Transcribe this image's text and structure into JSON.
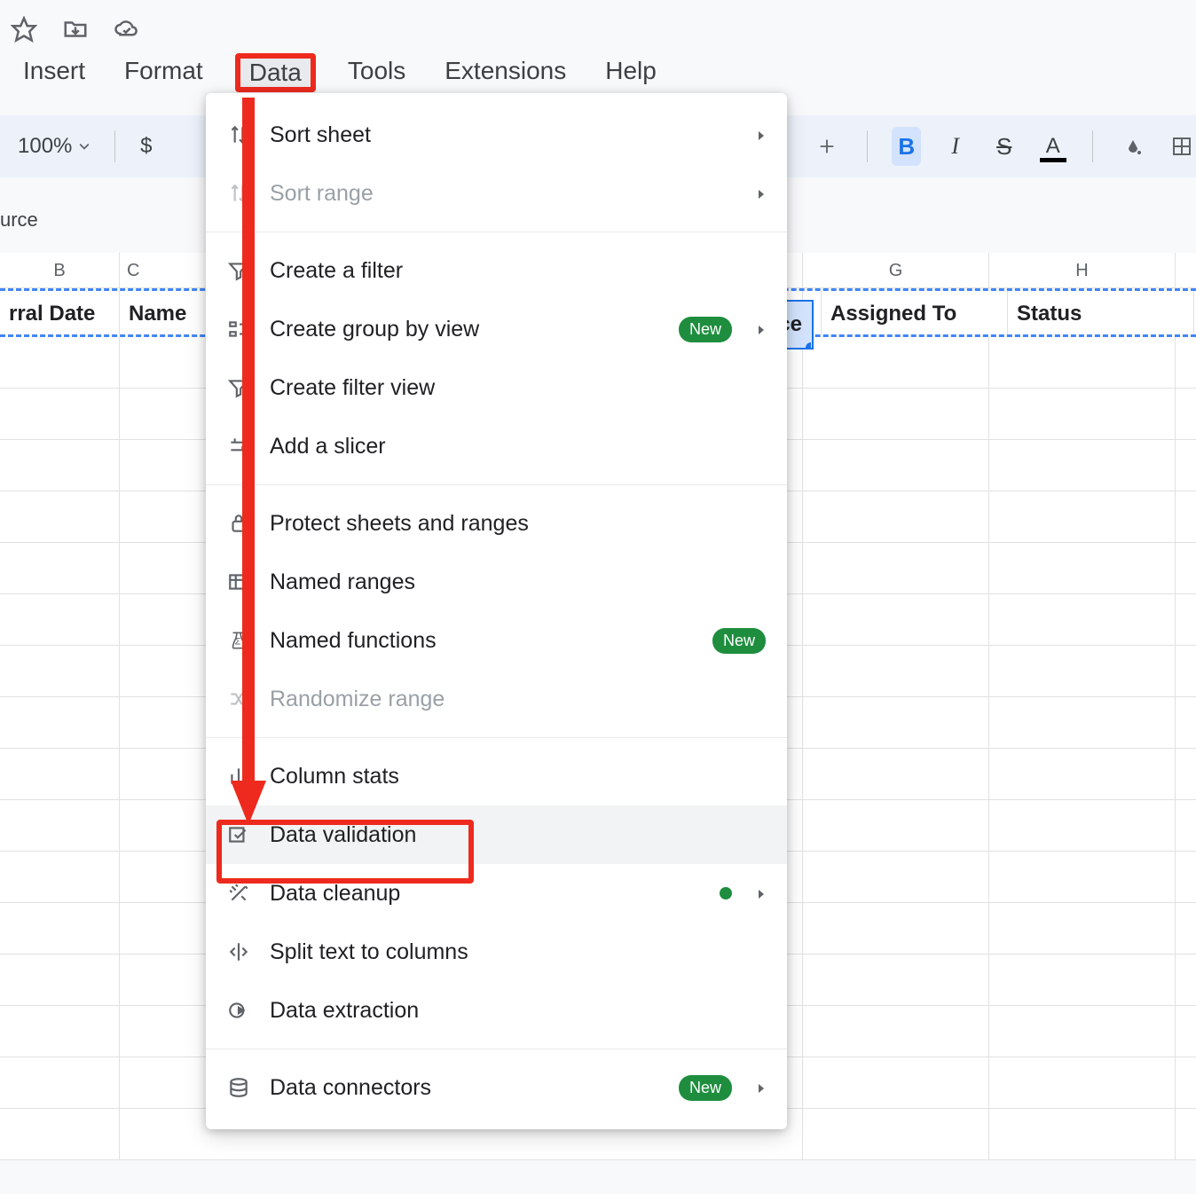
{
  "top_icons": [
    "star",
    "move-to",
    "cloud-check"
  ],
  "menubar": {
    "items": [
      "Insert",
      "Format",
      "Data",
      "Tools",
      "Extensions",
      "Help"
    ],
    "active": "Data"
  },
  "toolbar": {
    "zoom": "100%",
    "currency_symbol": "$",
    "right_items": [
      "plus",
      "bold",
      "italic",
      "strike",
      "text-color",
      "fill-color",
      "borders"
    ]
  },
  "source_snippet": "urce",
  "columns": {
    "B": "B",
    "C": "C",
    "G": "G",
    "H": "H"
  },
  "header_row": {
    "B": "rral Date",
    "C": "Name",
    "F_tail": "rce",
    "G": "Assigned To",
    "H": "Status"
  },
  "data_menu": [
    {
      "icon": "sort-sheet",
      "label": "Sort sheet",
      "submenu": true
    },
    {
      "icon": "sort-range",
      "label": "Sort range",
      "submenu": true,
      "disabled": true
    },
    {
      "sep": true
    },
    {
      "icon": "filter",
      "label": "Create a filter"
    },
    {
      "icon": "group-view",
      "label": "Create group by view",
      "badge": "New",
      "submenu": true
    },
    {
      "icon": "filter-view",
      "label": "Create filter view"
    },
    {
      "icon": "slicer",
      "label": "Add a slicer"
    },
    {
      "sep": true
    },
    {
      "icon": "protect",
      "label": "Protect sheets and ranges"
    },
    {
      "icon": "named-ranges",
      "label": "Named ranges"
    },
    {
      "icon": "named-functions",
      "label": "Named functions",
      "badge": "New"
    },
    {
      "icon": "randomize",
      "label": "Randomize range",
      "disabled": true
    },
    {
      "sep": true
    },
    {
      "icon": "column-stats",
      "label": "Column stats"
    },
    {
      "icon": "data-validation",
      "label": "Data validation",
      "hover": true,
      "highlighted": true
    },
    {
      "icon": "cleanup",
      "label": "Data cleanup",
      "dot": true,
      "submenu": true
    },
    {
      "icon": "split",
      "label": "Split text to columns"
    },
    {
      "icon": "extraction",
      "label": "Data extraction"
    },
    {
      "sep": true
    },
    {
      "icon": "connectors",
      "label": "Data connectors",
      "badge": "New",
      "submenu": true
    }
  ],
  "annotation": {
    "from": "Data menu",
    "to": "Data validation",
    "type": "red arrow + highlight boxes"
  }
}
